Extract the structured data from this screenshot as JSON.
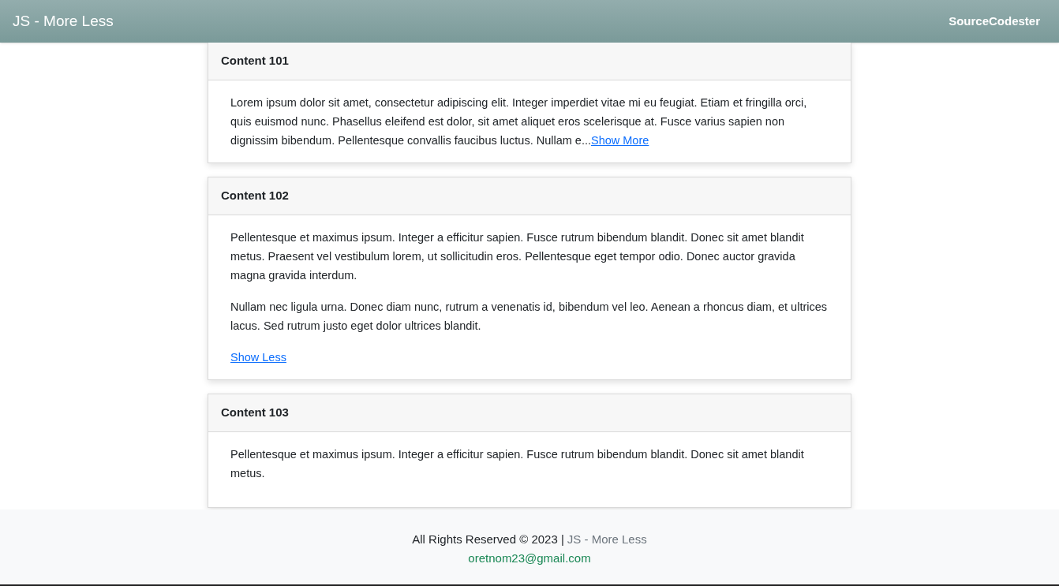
{
  "navbar": {
    "title": "JS - More Less",
    "brand": "SourceCodester"
  },
  "cards": [
    {
      "title": "Content 101",
      "expanded": false,
      "paragraphs": [
        "Lorem ipsum dolor sit amet, consectetur adipiscing elit. Integer imperdiet vitae mi eu feugiat. Etiam et fringilla orci, quis euismod nunc. Phasellus eleifend est dolor, sit amet aliquet eros scelerisque at. Fusce varius sapien non dignissim bibendum. Pellentesque convallis faucibus luctus. Nullam e..."
      ],
      "toggle": "Show More"
    },
    {
      "title": "Content 102",
      "expanded": true,
      "paragraphs": [
        "Pellentesque et maximus ipsum. Integer a efficitur sapien. Fusce rutrum bibendum blandit. Donec sit amet blandit metus. Praesent vel vestibulum lorem, ut sollicitudin eros. Pellentesque eget tempor odio. Donec auctor gravida magna gravida interdum.",
        "Nullam nec ligula urna. Donec diam nunc, rutrum a venenatis id, bibendum vel leo. Aenean a rhoncus diam, et ultrices lacus. Sed rutrum justo eget dolor ultrices blandit."
      ],
      "toggle": "Show Less"
    },
    {
      "title": "Content 103",
      "paragraphs": [
        "Pellentesque et maximus ipsum. Integer a efficitur sapien. Fusce rutrum bibendum blandit. Donec sit amet blandit metus."
      ]
    }
  ],
  "footer": {
    "text": "All Rights Reserved © 2023 |",
    "link": "JS - More Less",
    "email": "oretnom23@gmail.com"
  }
}
